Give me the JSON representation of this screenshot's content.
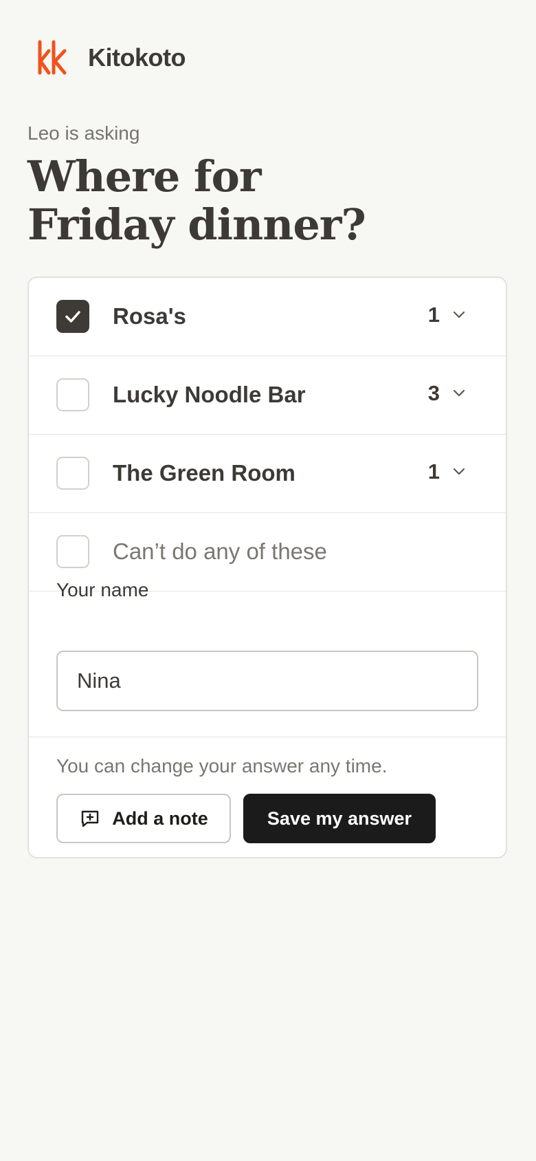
{
  "brand": {
    "name": "Kitokoto",
    "logo_color": "#f0531c"
  },
  "poll": {
    "asker": "Leo is asking",
    "question_line1": "Where for",
    "question_line2": "Friday dinner?",
    "options": [
      {
        "label": "Rosa's",
        "count": "1",
        "checked": true
      },
      {
        "label": "Lucky Noodle Bar",
        "count": "3",
        "checked": false
      },
      {
        "label": "The Green Room",
        "count": "1",
        "checked": false
      },
      {
        "label": "Can’t do any of these",
        "count": "",
        "checked": false
      }
    ]
  },
  "form": {
    "name_label": "Your name",
    "name_value": "Nina",
    "hint": "You can change your answer any time.",
    "note_button": "Add a note",
    "save_button": "Save my answer"
  },
  "icons": {
    "logo": "kk-logo-icon",
    "check": "check-icon",
    "chevron": "chevron-down-icon",
    "note": "message-plus-icon"
  },
  "colors": {
    "background": "#f7f7f4",
    "text": "#3d3a36",
    "muted": "#7a7671",
    "checked": "#3e3b37",
    "primary_button": "#1b1b1c"
  }
}
